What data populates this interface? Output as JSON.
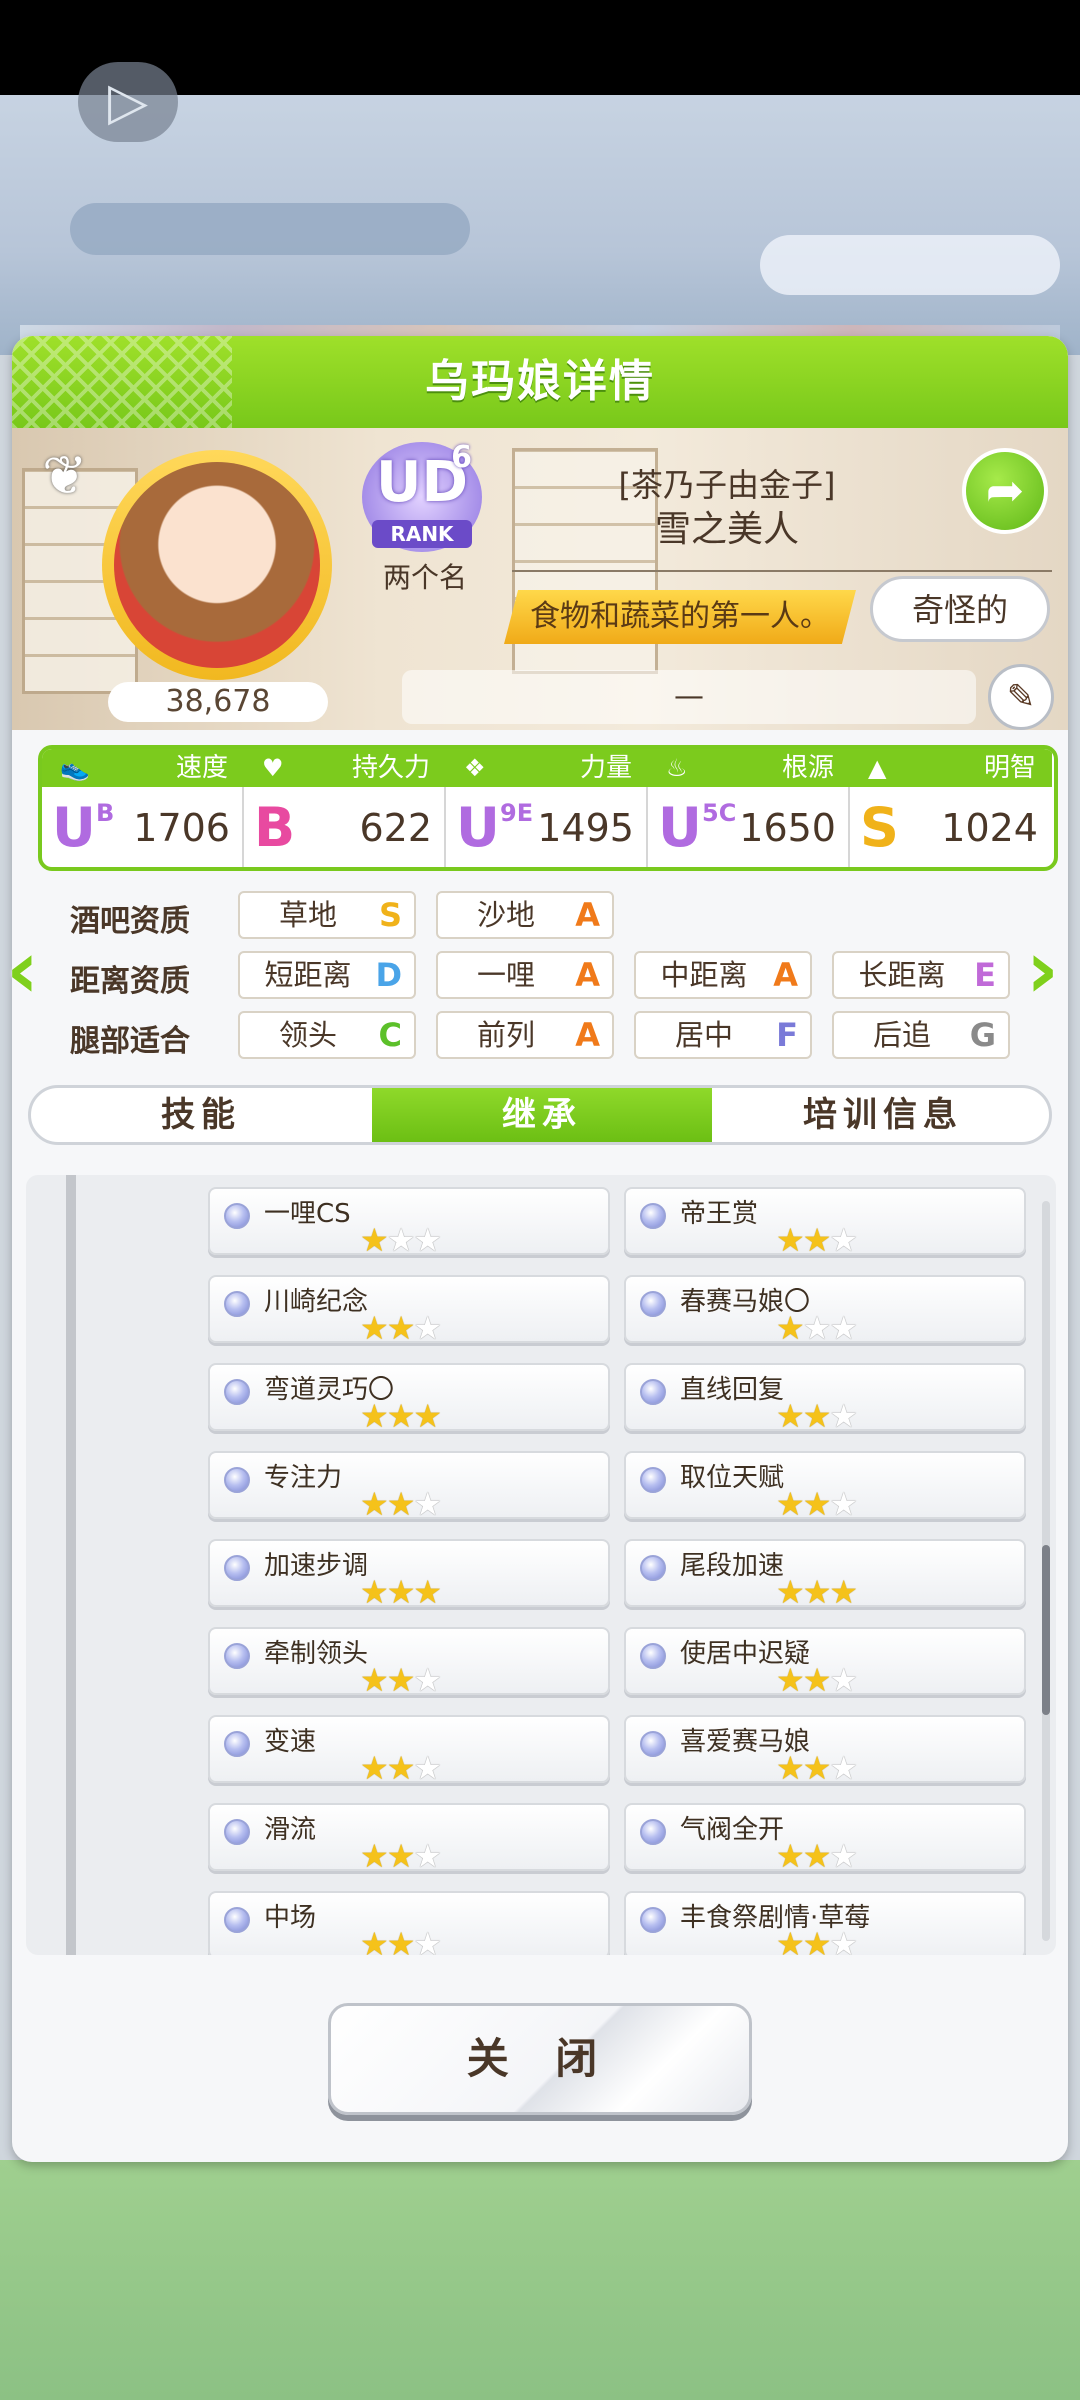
{
  "background": {
    "play_icon": "play-triangle-icon"
  },
  "panel": {
    "title": "乌玛娘详情"
  },
  "profile": {
    "fans": "38,678",
    "rank_level": "6",
    "rank_badge_letters": "UD",
    "rank_badge_word": "RANK",
    "rank_name": "两个名",
    "title_sub": "[茶乃子由金子]",
    "title_main": "雪之美人",
    "catchphrase": "食物和蔬菜的第一人。",
    "odd_button": "奇怪的",
    "memo": "—",
    "share_icon": "share-icon",
    "edit_icon": "pencil-icon",
    "carrot_icon": "carrot-icon"
  },
  "stats": [
    {
      "label": "速度",
      "icon": "shoe-icon",
      "grade": "U",
      "grade_sub": "B",
      "value": "1706",
      "color": "#b06be0"
    },
    {
      "label": "持久力",
      "icon": "heart-icon",
      "grade": "B",
      "grade_sub": "",
      "value": "622",
      "color": "#e84aa0"
    },
    {
      "label": "力量",
      "icon": "muscle-icon",
      "grade": "U",
      "grade_sub": "9E",
      "value": "1495",
      "color": "#b06be0"
    },
    {
      "label": "根源",
      "icon": "flame-icon",
      "grade": "U",
      "grade_sub": "5C",
      "value": "1650",
      "color": "#b06be0"
    },
    {
      "label": "明智",
      "icon": "graduation-cap-icon",
      "grade": "S",
      "grade_sub": "",
      "value": "1024",
      "color": "#f0b21a"
    }
  ],
  "aptitudes": {
    "rows": [
      {
        "label": "酒吧资质",
        "items": [
          {
            "name": "草地",
            "grade": "S",
            "color": "#f0b21a"
          },
          {
            "name": "沙地",
            "grade": "A",
            "color": "#f07a1a"
          }
        ]
      },
      {
        "label": "距离资质",
        "items": [
          {
            "name": "短距离",
            "grade": "D",
            "color": "#4aa4e8"
          },
          {
            "name": "一哩",
            "grade": "A",
            "color": "#f07a1a"
          },
          {
            "name": "中距离",
            "grade": "A",
            "color": "#f07a1a"
          },
          {
            "name": "长距离",
            "grade": "E",
            "color": "#c06ad8"
          }
        ]
      },
      {
        "label": "腿部适合",
        "items": [
          {
            "name": "领头",
            "grade": "C",
            "color": "#5cc02a"
          },
          {
            "name": "前列",
            "grade": "A",
            "color": "#f07a1a"
          },
          {
            "name": "居中",
            "grade": "F",
            "color": "#7a7ad8"
          },
          {
            "name": "后追",
            "grade": "G",
            "color": "#8a8a8a"
          }
        ]
      }
    ]
  },
  "tabs": [
    {
      "label": "技能",
      "active": false
    },
    {
      "label": "继承",
      "active": true
    },
    {
      "label": "培训信息",
      "active": false
    }
  ],
  "skills": [
    {
      "name": "一哩CS",
      "stars": 1
    },
    {
      "name": "帝王赏",
      "stars": 2
    },
    {
      "name": "川崎纪念",
      "stars": 2
    },
    {
      "name": "春赛马娘〇",
      "stars": 1
    },
    {
      "name": "弯道灵巧〇",
      "stars": 3
    },
    {
      "name": "直线回复",
      "stars": 2
    },
    {
      "name": "专注力",
      "stars": 2
    },
    {
      "name": "取位天赋",
      "stars": 2
    },
    {
      "name": "加速步调",
      "stars": 3
    },
    {
      "name": "尾段加速",
      "stars": 3
    },
    {
      "name": "牵制领头",
      "stars": 2
    },
    {
      "name": "使居中迟疑",
      "stars": 2
    },
    {
      "name": "变速",
      "stars": 2
    },
    {
      "name": "喜爱赛马娘",
      "stars": 2
    },
    {
      "name": "滑流",
      "stars": 2
    },
    {
      "name": "气阀全开",
      "stars": 2
    },
    {
      "name": "中场",
      "stars": 2
    },
    {
      "name": "丰食祭剧情·草莓",
      "stars": 2
    }
  ],
  "close_button": "关 闭"
}
